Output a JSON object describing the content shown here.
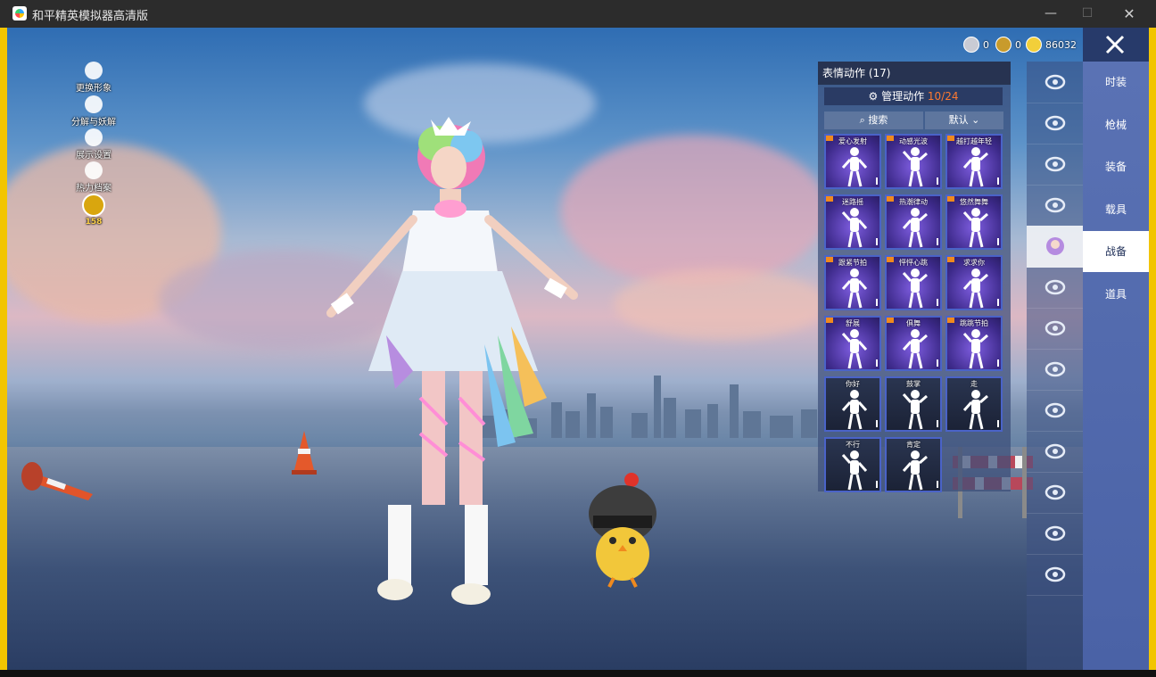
{
  "window": {
    "title": "和平精英模拟器高清版",
    "controls": {
      "minimize": "—",
      "maximize": "☐",
      "close": "✕"
    }
  },
  "currency": [
    {
      "icon": "silver-coin-icon",
      "value": "0"
    },
    {
      "icon": "gold-token-icon",
      "value": "0"
    },
    {
      "icon": "coupon-icon",
      "value": "86032"
    }
  ],
  "left_menu": [
    {
      "label": "更换形象",
      "icon": "person-icon"
    },
    {
      "label": "分解与妖解",
      "icon": "gear-icon"
    },
    {
      "label": "展示设置",
      "icon": "eye-icon"
    },
    {
      "label": "热力档案",
      "icon": "flame-icon"
    },
    {
      "label": "158",
      "icon": "level-badge-icon"
    }
  ],
  "emote_panel": {
    "title": "表情动作 (17)",
    "manage_label": "管理动作",
    "manage_count": "10/24",
    "search_label": "搜索",
    "sort_label": "默认",
    "items": [
      {
        "label": "爱心发射"
      },
      {
        "label": "动感光波"
      },
      {
        "label": "越打越年轻"
      },
      {
        "label": "迷路摇"
      },
      {
        "label": "热潮律动"
      },
      {
        "label": "悠然舞舞"
      },
      {
        "label": "跟紧节拍"
      },
      {
        "label": "怦怦心跳"
      },
      {
        "label": "求求你"
      },
      {
        "label": "舒展"
      },
      {
        "label": "俱舞"
      },
      {
        "label": "跳跳节拍"
      },
      {
        "label": "你好"
      },
      {
        "label": "鼓掌"
      },
      {
        "label": "走"
      },
      {
        "label": "不行"
      },
      {
        "label": "肯定"
      }
    ]
  },
  "categories": [
    {
      "icon": "helmet-icon"
    },
    {
      "icon": "backpack-icon"
    },
    {
      "icon": "drone-icon"
    },
    {
      "icon": "plane-icon"
    },
    {
      "icon": "avatar-emote-icon"
    },
    {
      "icon": "robot-pet-icon"
    },
    {
      "icon": "speaker-icon"
    },
    {
      "icon": "frame-icon"
    },
    {
      "icon": "picture-icon"
    },
    {
      "icon": "extinguisher-icon"
    },
    {
      "icon": "hand-effect-icon"
    },
    {
      "icon": "sparkle-icon"
    },
    {
      "icon": "parachute-icon"
    }
  ],
  "tabs": [
    {
      "label": "时装"
    },
    {
      "label": "枪械"
    },
    {
      "label": "装备"
    },
    {
      "label": "载具"
    },
    {
      "label": "战备",
      "active": true
    },
    {
      "label": "道具"
    }
  ]
}
